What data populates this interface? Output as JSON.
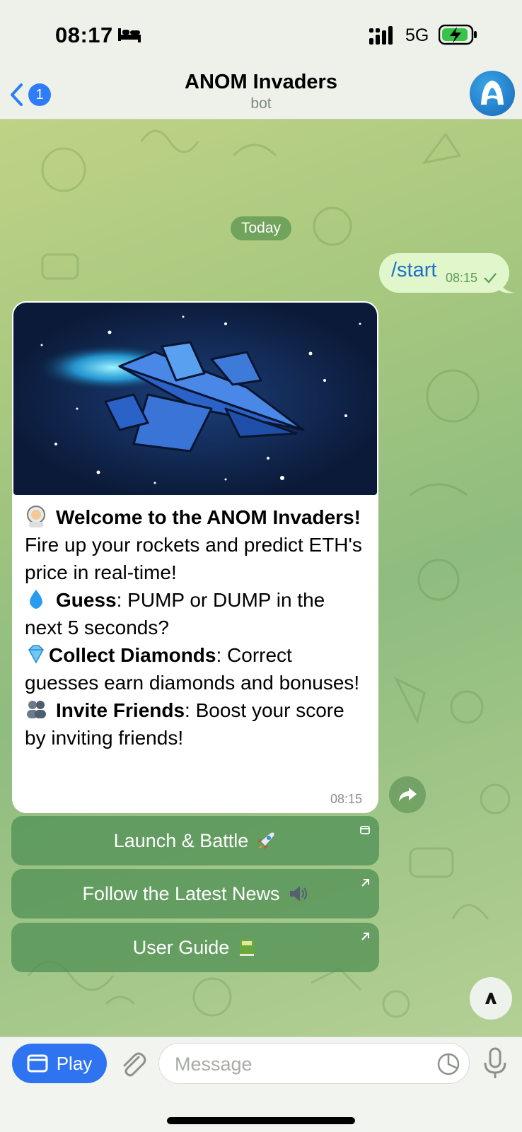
{
  "status_bar": {
    "time": "08:17",
    "network": "5G",
    "icons": [
      "bed-icon",
      "signal-icon",
      "battery-charging-icon"
    ]
  },
  "header": {
    "back_badge": "1",
    "title": "ANOM Invaders",
    "subtitle": "bot",
    "avatar_icon": "anom-logo-icon"
  },
  "chat": {
    "date_chip": "Today",
    "outgoing": {
      "text": "/start",
      "time": "08:15",
      "status_icon": "check-icon"
    },
    "incoming": {
      "image_alt": "blue spaceship in space",
      "line1_bold": "Welcome to the ANOM Invaders!",
      "line2": "Fire up your rockets and predict ETH's price in real-time!",
      "guess_label": "Guess",
      "guess_text": ": PUMP or DUMP in the next 5 seconds?",
      "collect_label": "Collect Diamonds",
      "collect_text": ": Correct guesses earn diamonds and bonuses!",
      "invite_label": "Invite Friends",
      "invite_text": ": Boost your score by inviting friends!",
      "time": "08:15"
    },
    "buttons": [
      {
        "label": "Launch & Battle",
        "emoji": "rocket-icon",
        "corner": "webapp-icon"
      },
      {
        "label": "Follow the Latest News",
        "emoji": "speaker-icon",
        "corner": "external-link-icon"
      },
      {
        "label": "User Guide",
        "emoji": "book-icon",
        "corner": "external-link-icon"
      }
    ]
  },
  "input_bar": {
    "play_label": "Play",
    "placeholder": "Message"
  },
  "colors": {
    "accent": "#2e74f0",
    "bubble_out": "#e1f7cb",
    "keyboard_button": "#4c8e52"
  }
}
